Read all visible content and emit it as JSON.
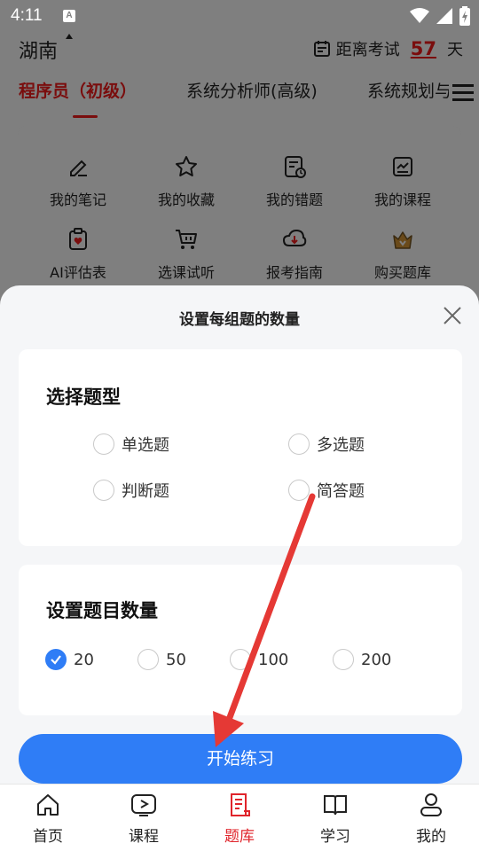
{
  "status_bar": {
    "time": "4:11",
    "notification_glyph": "A"
  },
  "header": {
    "region": "湖南",
    "exam_countdown": {
      "prefix": "距离考试",
      "days": "57",
      "suffix": "天"
    }
  },
  "tabs": [
    {
      "label": "程序员（初级）",
      "active": true
    },
    {
      "label": "系统分析师(高级)",
      "active": false
    },
    {
      "label": "系统规划与",
      "active": false
    }
  ],
  "shortcuts": [
    {
      "label": "我的笔记",
      "icon": "note-edit-icon"
    },
    {
      "label": "我的收藏",
      "icon": "star-icon"
    },
    {
      "label": "我的错题",
      "icon": "wrong-questions-icon"
    },
    {
      "label": "我的课程",
      "icon": "course-icon"
    },
    {
      "label": "AI评估表",
      "icon": "clipboard-heart-icon"
    },
    {
      "label": "选课试听",
      "icon": "cart-icon"
    },
    {
      "label": "报考指南",
      "icon": "cloud-download-icon"
    },
    {
      "label": "购买题库",
      "icon": "crown-bag-icon"
    }
  ],
  "sheet": {
    "title": "设置每组题的数量",
    "type_section": {
      "title": "选择题型",
      "options": [
        {
          "label": "单选题",
          "checked": false
        },
        {
          "label": "多选题",
          "checked": false
        },
        {
          "label": "判断题",
          "checked": false
        },
        {
          "label": "简答题",
          "checked": false
        }
      ]
    },
    "count_section": {
      "title": "设置题目数量",
      "options": [
        {
          "label": "20",
          "checked": true
        },
        {
          "label": "50",
          "checked": false
        },
        {
          "label": "100",
          "checked": false
        },
        {
          "label": "200",
          "checked": false
        }
      ]
    },
    "start_button": "开始练习"
  },
  "bottom_nav": [
    {
      "label": "首页",
      "icon": "home-icon",
      "active": false
    },
    {
      "label": "课程",
      "icon": "video-play-icon",
      "active": false
    },
    {
      "label": "题库",
      "icon": "question-bank-icon",
      "active": true
    },
    {
      "label": "学习",
      "icon": "book-icon",
      "active": false
    },
    {
      "label": "我的",
      "icon": "user-icon",
      "active": false
    }
  ],
  "colors": {
    "accent_blue": "#2f7df6",
    "active_red": "#e0242b",
    "overlay_gray": "#7f7f7f",
    "annotation_arrow": "#e53935"
  }
}
